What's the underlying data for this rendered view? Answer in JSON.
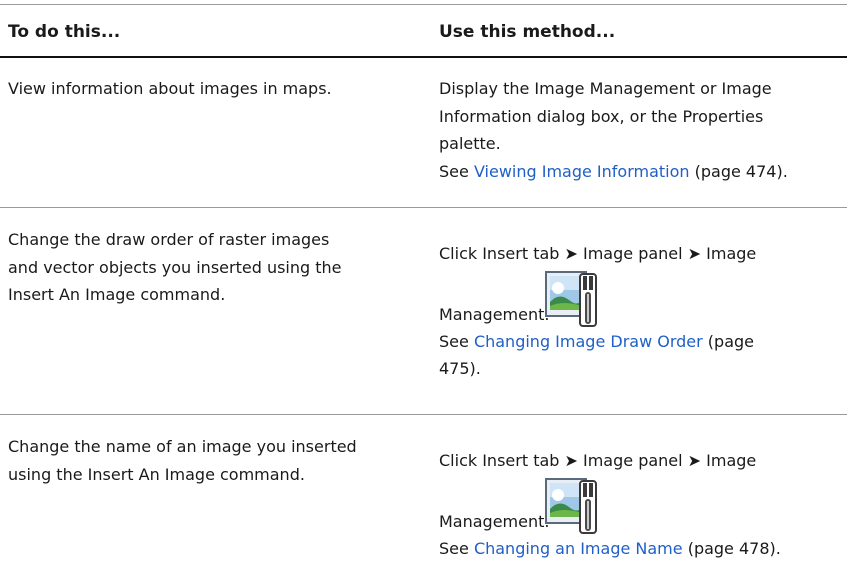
{
  "table": {
    "headers": {
      "col1": "To do this...",
      "col2": "Use this method..."
    },
    "rows": [
      {
        "task": "View information about images in maps.",
        "method_line1": "Display the Image Management or Image",
        "method_line2": "Information dialog box, or the Properties",
        "method_line3": "palette.",
        "see": "See ",
        "link": "Viewing Image Information",
        "page": " (page 474)."
      },
      {
        "task_line1": "Change the draw order of raster images",
        "task_line2": "and vector objects you inserted using the",
        "task_line3": "Insert An Image command.",
        "method_line1": "Click Insert tab ➤ Image panel ➤ Image",
        "method_line2": "Management.",
        "icon": "image-management-icon",
        "see": "See ",
        "link": "Changing Image Draw Order",
        "page_line1": " (page",
        "page_line2": "475)."
      },
      {
        "task_line1": "Change the name of an image you inserted",
        "task_line2": "using the Insert An Image command.",
        "method_line1": "Click Insert tab ➤ Image panel ➤ Image",
        "method_line2": "Management.",
        "icon": "image-management-icon",
        "see": "See ",
        "link": "Changing an Image Name",
        "page": " (page 478)."
      }
    ]
  },
  "colors": {
    "link": "#1f5fc7",
    "text": "#1a1a1a",
    "rule": "#9a9a9a"
  }
}
